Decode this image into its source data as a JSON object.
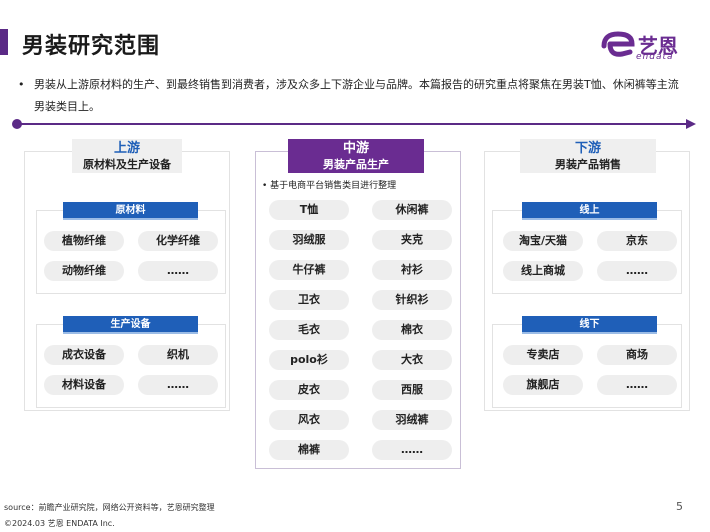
{
  "header": {
    "title": "男装研究范围",
    "logo_cn": "艺恩",
    "logo_en": "endata"
  },
  "intro": {
    "bullet": "•",
    "text": "男装从上游原材料的生产、到最终销售到消费者，涉及众多上下游企业与品牌。本篇报告的研究重点将聚焦在男装T恤、休闲裤等主流男装类目上。"
  },
  "upstream": {
    "title": "上游",
    "subtitle": "原材料及生产设备",
    "groups": [
      {
        "label": "原材料",
        "items": [
          "植物纤维",
          "化学纤维",
          "动物纤维",
          "……"
        ]
      },
      {
        "label": "生产设备",
        "items": [
          "成衣设备",
          "织机",
          "材料设备",
          "……"
        ]
      }
    ]
  },
  "midstream": {
    "title": "中游",
    "subtitle": "男装产品生产",
    "note": "基于电商平台销售类目进行整理",
    "items": [
      "T恤",
      "休闲裤",
      "羽绒服",
      "夹克",
      "牛仔裤",
      "衬衫",
      "卫衣",
      "针织衫",
      "毛衣",
      "棉衣",
      "polo衫",
      "大衣",
      "皮衣",
      "西服",
      "风衣",
      "羽绒裤",
      "棉裤",
      "……"
    ]
  },
  "downstream": {
    "title": "下游",
    "subtitle": "男装产品销售",
    "groups": [
      {
        "label": "线上",
        "items": [
          "淘宝/天猫",
          "京东",
          "线上商城",
          "……"
        ]
      },
      {
        "label": "线下",
        "items": [
          "专卖店",
          "商场",
          "旗舰店",
          "……"
        ]
      }
    ]
  },
  "footer": {
    "source": "source：前瞻产业研究院，网络公开资料等，艺恩研究整理",
    "copyright": "©2024.03 艺恩 ENDATA Inc.",
    "page": "5"
  },
  "colors": {
    "brand_purple": "#5b2a86",
    "label_blue": "#1f5fb8",
    "pill_gray": "#eeeeee"
  }
}
